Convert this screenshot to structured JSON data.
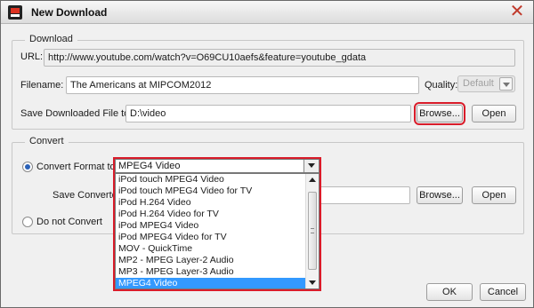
{
  "window": {
    "title": "New Download",
    "icon": "app-icon",
    "close_icon": "close-icon"
  },
  "download": {
    "legend": "Download",
    "url_label": "URL:",
    "url_value": "http://www.youtube.com/watch?v=O69CU10aefs&feature=youtube_gdata",
    "filename_label": "Filename:",
    "filename_value": "The Americans at MIPCOM2012",
    "quality_label": "Quality:",
    "quality_value": "Default",
    "save_label": "Save Downloaded File to:",
    "save_value": "D:\\video",
    "browse_label": "Browse...",
    "open_label": "Open"
  },
  "convert": {
    "legend": "Convert",
    "format_radio_label": "Convert Format to:",
    "format_selected": "MPEG4 Video",
    "save_converted_label": "Save Converted",
    "browse_label": "Browse...",
    "open_label": "Open",
    "no_convert_label": "Do not Convert",
    "options": [
      "iPod touch MPEG4 Video",
      "iPod touch MPEG4 Video for TV",
      "iPod H.264 Video",
      "iPod H.264 Video for TV",
      "iPod MPEG4 Video",
      "iPod MPEG4 Video for TV",
      "MOV - QuickTime",
      "MP2 - MPEG Layer-2 Audio",
      "MP3 - MPEG Layer-3 Audio",
      "MPEG4 Video"
    ],
    "highlighted_option": "MPEG4 Video"
  },
  "footer": {
    "ok_label": "OK",
    "cancel_label": "Cancel"
  },
  "colors": {
    "highlight_frame": "#d91c2a",
    "selection": "#3399ff"
  }
}
